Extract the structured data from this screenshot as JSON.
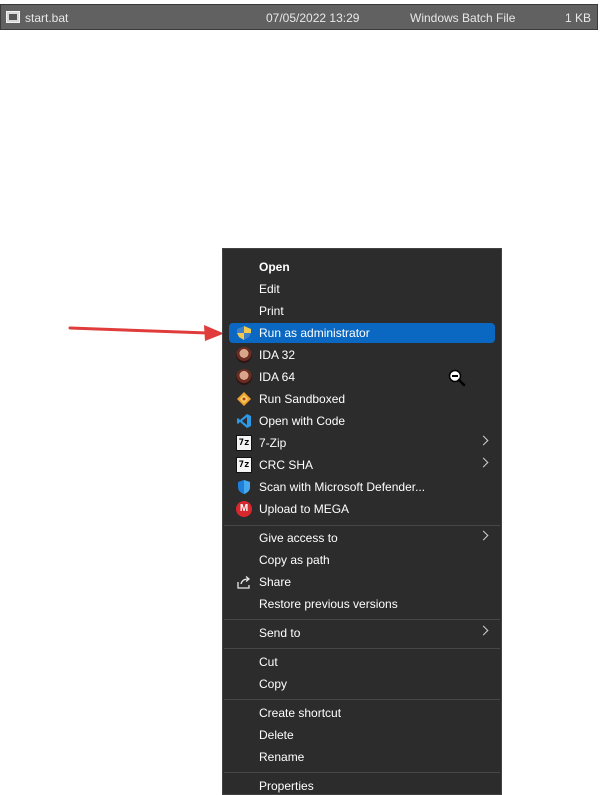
{
  "file_row": {
    "name": "start.bat",
    "date": "07/05/2022 13:29",
    "type": "Windows Batch File",
    "size": "1 KB"
  },
  "menu": {
    "open": "Open",
    "edit": "Edit",
    "print": "Print",
    "run_as_admin": "Run as administrator",
    "ida32": "IDA 32",
    "ida64": "IDA 64",
    "run_sandboxed": "Run Sandboxed",
    "open_with_code": "Open with Code",
    "seven_zip": "7-Zip",
    "crc_sha": "CRC SHA",
    "scan_defender": "Scan with Microsoft Defender...",
    "upload_mega": "Upload to MEGA",
    "give_access": "Give access to",
    "copy_as_path": "Copy as path",
    "share": "Share",
    "restore_versions": "Restore previous versions",
    "send_to": "Send to",
    "cut": "Cut",
    "copy": "Copy",
    "create_shortcut": "Create shortcut",
    "delete": "Delete",
    "rename": "Rename",
    "properties": "Properties"
  },
  "icons": {
    "seven_zip_glyph": "7z",
    "mega_glyph": "M"
  },
  "colors": {
    "highlight": "#0b68c2",
    "arrow": "#e03c3c",
    "menu_bg": "#2c2c2c"
  }
}
